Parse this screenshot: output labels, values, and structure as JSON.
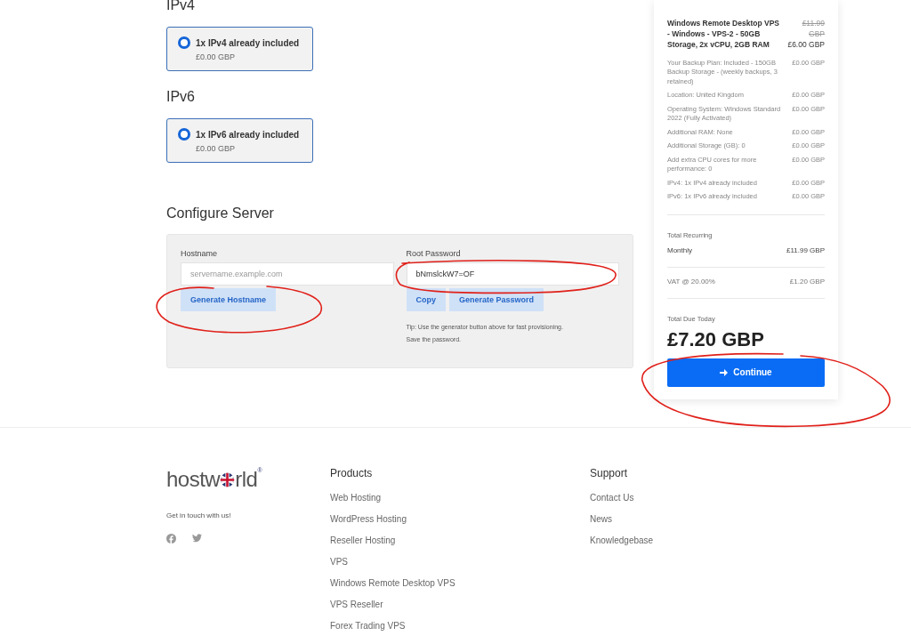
{
  "ip_sections": [
    {
      "title": "IPv4",
      "options": [
        {
          "label": "1x IPv4 already included",
          "price": "£0.00 GBP",
          "selected": true
        }
      ]
    },
    {
      "title": "IPv6",
      "options": [
        {
          "label": "1x IPv6 already included",
          "price": "£0.00 GBP",
          "selected": true
        }
      ]
    }
  ],
  "configure_server": {
    "title": "Configure Server",
    "hostname": {
      "label": "Hostname",
      "placeholder": "servername.example.com",
      "buttons": [
        "Generate Hostname"
      ]
    },
    "root_password": {
      "label": "Root Password",
      "value": "bNmslckW7=OF",
      "buttons": [
        "Copy",
        "Generate Password"
      ]
    },
    "tips": [
      "Tip: Use the generator button above for fast provisioning.",
      "Save the password."
    ]
  },
  "order_summary": {
    "items": [
      {
        "kind": "product",
        "label": "Windows Remote Desktop VPS - Windows - VPS-2 - 50GB Storage, 2x vCPU, 2GB RAM",
        "old_price": "£11.99 GBP",
        "price": "£6.00 GBP"
      },
      {
        "kind": "addon",
        "label": "Your Backup Plan: Included - 150GB Backup Storage - (weekly backups, 3 retained)",
        "price": "£0.00 GBP"
      },
      {
        "kind": "addon",
        "label": "Location: United Kingdom",
        "price": "£0.00 GBP"
      },
      {
        "kind": "addon",
        "label": "Operating System: Windows Standard 2022 (Fully Activated)",
        "price": "£0.00 GBP"
      },
      {
        "kind": "addon",
        "label": "Additional RAM: None",
        "price": "£0.00 GBP"
      },
      {
        "kind": "addon",
        "label": "Additional Storage (GB): 0",
        "price": "£0.00 GBP"
      },
      {
        "kind": "addon",
        "label": "Add extra CPU cores for more performance: 0",
        "price": "£0.00 GBP"
      },
      {
        "kind": "addon",
        "label": "IPv4: 1x IPv4 already included",
        "price": "£0.00 GBP"
      },
      {
        "kind": "addon",
        "label": "IPv6: 1x IPv6 already included",
        "price": "£0.00 GBP"
      }
    ],
    "recurring_label": "Total Recurring",
    "recurring": {
      "label": "Monthly",
      "price": "£11.99 GBP"
    },
    "vat": {
      "label": "VAT @ 20.00%",
      "price": "£1.20 GBP"
    },
    "total_label": "Total Due Today",
    "total": "£7.20 GBP",
    "continue_button": "Continue"
  },
  "footer": {
    "logo": {
      "parts": [
        "hostw",
        "rld"
      ],
      "mark": "®"
    },
    "tagline": "Get in touch with us!",
    "columns": [
      {
        "title": "Products",
        "links": [
          "Web Hosting",
          "WordPress Hosting",
          "Reseller Hosting",
          "VPS",
          "Windows Remote Desktop VPS",
          "VPS Reseller",
          "Forex Trading VPS"
        ]
      },
      {
        "title": "Support",
        "links": [
          "Contact Us",
          "News",
          "Knowledgebase"
        ]
      }
    ]
  },
  "annotations": [
    {
      "kind": "freehand-circle"
    },
    {
      "kind": "freehand-circle"
    },
    {
      "kind": "freehand-circle"
    }
  ]
}
